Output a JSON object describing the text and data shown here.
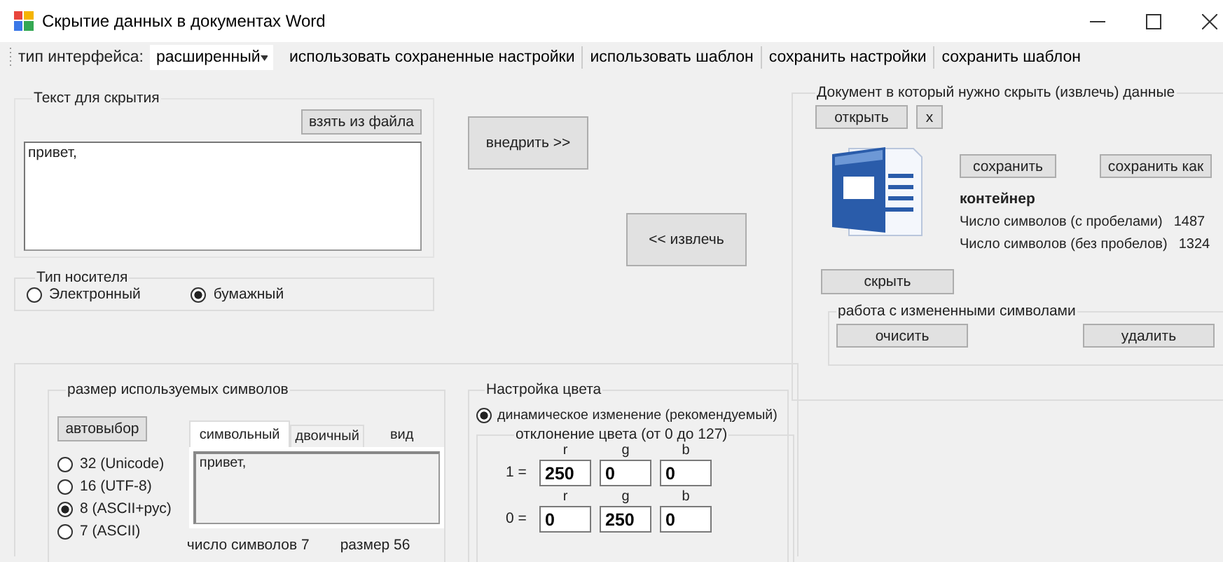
{
  "window": {
    "title": "Скрытие данных в документах Word"
  },
  "toolbar": {
    "interface_label": "тип интерфейса:",
    "interface_value": "расширенный",
    "buttons": [
      "использовать сохраненные настройки",
      "использовать шаблон",
      "сохранить настройки",
      "сохранить шаблон"
    ]
  },
  "hide_text": {
    "title": "Текст для скрытия",
    "file_button": "взять из файла",
    "value": "привет,"
  },
  "carrier": {
    "title": "Тип носителя",
    "options": [
      {
        "label": "Электронный",
        "selected": false
      },
      {
        "label": "бумажный",
        "selected": true
      }
    ]
  },
  "actions": {
    "embed": "внедрить >>",
    "extract": "<< извлечь"
  },
  "document": {
    "title": "Документ в который нужно скрыть (извлечь) данные",
    "open_button": "открыть",
    "close_button": "x",
    "save_button": "сохранить",
    "save_as_button": "сохранить как",
    "name": "контейнер",
    "stats": [
      {
        "label": "Число символов (с пробелами)",
        "value": "1487"
      },
      {
        "label": "Число символов (без пробелов)",
        "value": "1324"
      }
    ],
    "hide_button": "скрыть",
    "changed": {
      "title": "работа с измененными символами",
      "buttons": [
        "очисить",
        "удалить"
      ]
    }
  },
  "symbol_size": {
    "title": "размер используемых символов",
    "auto_button": "автовыбор",
    "options": [
      {
        "label": "32 (Unicode)",
        "selected": false
      },
      {
        "label": "16 (UTF-8)",
        "selected": false
      },
      {
        "label": "8 (ASCII+рус)",
        "selected": true
      },
      {
        "label": "7 (ASCII)",
        "selected": false
      }
    ],
    "tabs": [
      {
        "label": "символьный",
        "selected": true
      },
      {
        "label": "двоичный",
        "selected": false
      }
    ],
    "view_label": "вид",
    "preview": "привет,",
    "count_label": "число символов 7",
    "size_label": "размер 56"
  },
  "color": {
    "title": "Настройка цвета",
    "mode": {
      "label": "динамическое изменение (рекомендуемый)",
      "selected": true
    },
    "deviation_title": "отклонение цвета (от 0 до 127)",
    "rows": [
      {
        "label": "1 =",
        "channels": [
          {
            "name": "r",
            "value": "250"
          },
          {
            "name": "g",
            "value": "0"
          },
          {
            "name": "b",
            "value": "0"
          }
        ]
      },
      {
        "label": "0 =",
        "channels": [
          {
            "name": "r",
            "value": "0"
          },
          {
            "name": "g",
            "value": "250"
          },
          {
            "name": "b",
            "value": "0"
          }
        ]
      }
    ]
  }
}
